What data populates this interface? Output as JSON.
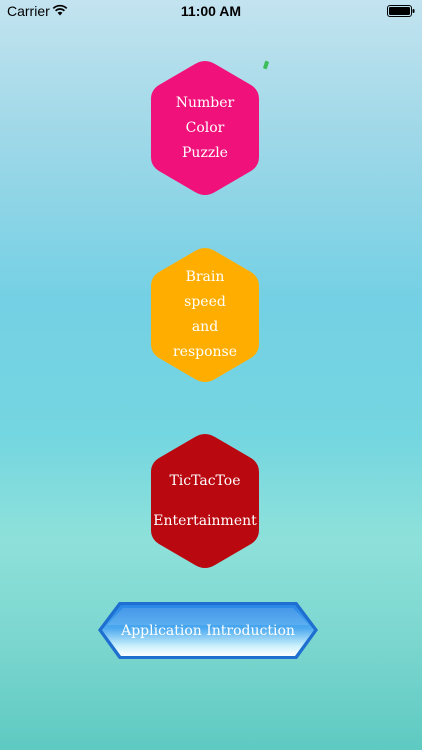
{
  "status_bar": {
    "carrier": "Carrier",
    "time": "11:00 AM"
  },
  "menu": {
    "items": [
      {
        "label": "Number\nColor\nPuzzle",
        "color": "#f0127a"
      },
      {
        "label": "Brain\nspeed\nand\nresponse",
        "color": "#ffae00"
      },
      {
        "label": "TicTacToe\nEntertainment",
        "color": "#ba0810"
      }
    ],
    "intro_button": {
      "label": "Application Introduction",
      "color": "#4aa8ef"
    }
  }
}
